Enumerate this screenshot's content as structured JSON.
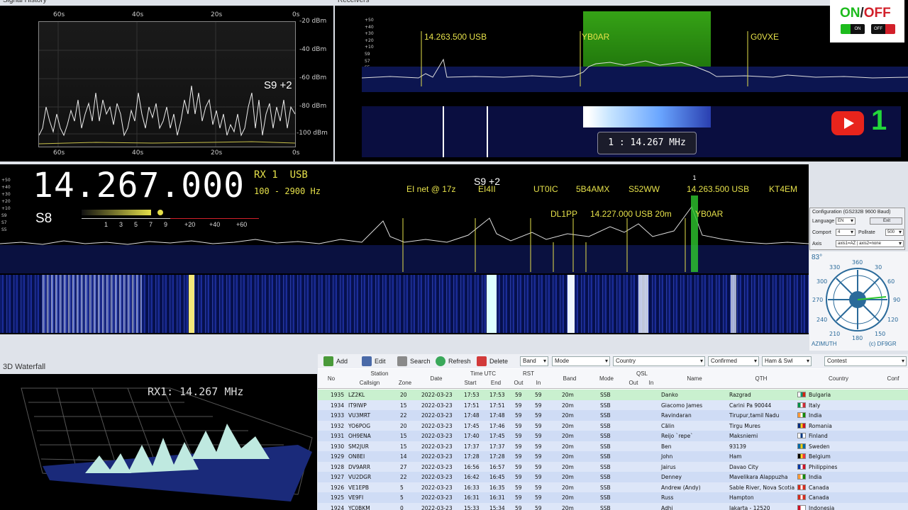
{
  "signal_history": {
    "title": "Signal History",
    "time_ticks": [
      "60s",
      "40s",
      "20s",
      "0s"
    ],
    "dbm_ticks": [
      "-20 dBm",
      "-40 dBm",
      "-60 dBm",
      "-80 dBm",
      "-100 dBm"
    ],
    "s_reading": "S9 +2"
  },
  "receivers": {
    "title": "Receivers",
    "db_ticks": [
      "+50",
      "+40",
      "+30",
      "+20",
      "+10",
      "S9",
      "S7",
      "S5",
      "S3"
    ],
    "markers": [
      "14.263.500 USB",
      "YB0AR",
      "G0VXE"
    ],
    "tuner_readout": "1 : 14.267 MHz",
    "channel_number": "1"
  },
  "onoff": {
    "on_label": "ON",
    "sep": "/",
    "off_label": "OFF",
    "on_sw": "ON",
    "off_sw": "OFF"
  },
  "main": {
    "frequency": "14.267.000",
    "rx_label": "RX 1",
    "mode": "USB",
    "bandwidth": "100 - 2900 Hz",
    "s_meter": "S8",
    "s_scale": [
      "1",
      "3",
      "5",
      "7",
      "9",
      "+20",
      "+40",
      "+60"
    ],
    "peak_label": "S9 +2",
    "db_ticks": [
      "+50",
      "+40",
      "+30",
      "+20",
      "+10",
      "S9",
      "S7",
      "S5"
    ],
    "spots": [
      "EI net @ 17z",
      "EI4II",
      "UT0IC",
      "5B4AMX",
      "S52WW",
      "14.263.500 USB",
      "KT4EM",
      "DL1PP",
      "14.227.000 USB 20m",
      "YB0AR"
    ],
    "spot_tag": "1"
  },
  "config": {
    "title": "Configuration (GS232B 9600 Baud)",
    "language_label": "Language",
    "language": "EN",
    "exit": "Exit",
    "comport_label": "Comport",
    "comport": "4",
    "pollrate_label": "Pollrate",
    "pollrate": "500",
    "axis_label": "Axis",
    "axis": "axis1=AZ | axis2=none"
  },
  "compass": {
    "reading": "83°",
    "degrees": [
      "360",
      "30",
      "60",
      "90",
      "120",
      "150",
      "180",
      "210",
      "240",
      "270",
      "300",
      "330"
    ],
    "label": "AZIMUTH",
    "credit": "(c) DF9GR"
  },
  "waterfall3d": {
    "title": "3D Waterfall",
    "label": "RX1: 14.267 MHz"
  },
  "log": {
    "toolbar": {
      "add": "Add",
      "edit": "Edit",
      "search": "Search",
      "refresh": "Refresh",
      "delete": "Delete"
    },
    "filters": [
      "Band",
      "Mode",
      "Country",
      "Confirmed",
      "Ham & Swl",
      "Contest"
    ],
    "headers": {
      "no": "No",
      "station": "Station",
      "callsign": "Callsign",
      "zone": "Zone",
      "date": "Date",
      "time_utc": "Time UTC",
      "start": "Start",
      "end": "End",
      "rst": "RST",
      "out": "Out",
      "in": "In",
      "band": "Band",
      "mode": "Mode",
      "qsl": "QSL",
      "qsl_out": "Out",
      "qsl_in": "In",
      "name": "Name",
      "qth": "QTH",
      "country": "Country",
      "conf": "Conf"
    },
    "rows": [
      {
        "no": "1935",
        "call": "LZ2KL",
        "zone": "20",
        "date": "2022-03-23",
        "start": "17:53",
        "end": "17:53",
        "out": "59",
        "in": "59",
        "band": "20m",
        "mode": "SSB",
        "name": "Danko",
        "qth": "Razgrad",
        "country": "Bulgaria",
        "flag": [
          "#ffffff",
          "#00966e",
          "#d62612"
        ]
      },
      {
        "no": "1934",
        "call": "IT9IWP",
        "zone": "15",
        "date": "2022-03-23",
        "start": "17:51",
        "end": "17:51",
        "out": "59",
        "in": "59",
        "band": "20m",
        "mode": "SSB",
        "name": "Giacomo James",
        "qth": "Carini Pa 90044",
        "country": "Italy",
        "flag": [
          "#009246",
          "#ffffff",
          "#ce2b37"
        ]
      },
      {
        "no": "1933",
        "call": "VU3MRT",
        "zone": "22",
        "date": "2022-03-23",
        "start": "17:48",
        "end": "17:48",
        "out": "59",
        "in": "59",
        "band": "20m",
        "mode": "SSB",
        "name": "Ravindaran",
        "qth": "Tirupur,tamil Nadu",
        "country": "India",
        "flag": [
          "#ff9933",
          "#ffffff",
          "#138808"
        ]
      },
      {
        "no": "1932",
        "call": "YO6POG",
        "zone": "20",
        "date": "2022-03-23",
        "start": "17:45",
        "end": "17:46",
        "out": "59",
        "in": "59",
        "band": "20m",
        "mode": "SSB",
        "name": "Călin",
        "qth": "Tirgu Mures",
        "country": "Romania",
        "flag": [
          "#002b7f",
          "#fcd116",
          "#ce1126"
        ]
      },
      {
        "no": "1931",
        "call": "OH9ENA",
        "zone": "15",
        "date": "2022-03-23",
        "start": "17:40",
        "end": "17:45",
        "out": "59",
        "in": "59",
        "band": "20m",
        "mode": "SSB",
        "name": "Reijo `repe`",
        "qth": "Maksniemi",
        "country": "Finland",
        "flag": [
          "#ffffff",
          "#003580",
          "#ffffff"
        ]
      },
      {
        "no": "1930",
        "call": "SM2JUR",
        "zone": "15",
        "date": "2022-03-23",
        "start": "17:37",
        "end": "17:37",
        "out": "59",
        "in": "59",
        "band": "20m",
        "mode": "SSB",
        "name": "Ben",
        "qth": "93139",
        "country": "Sweden",
        "flag": [
          "#006aa7",
          "#fecc00",
          "#006aa7"
        ]
      },
      {
        "no": "1929",
        "call": "ON8EI",
        "zone": "14",
        "date": "2022-03-23",
        "start": "17:28",
        "end": "17:28",
        "out": "59",
        "in": "59",
        "band": "20m",
        "mode": "SSB",
        "name": "John",
        "qth": "Ham",
        "country": "Belgium",
        "flag": [
          "#000000",
          "#fdda24",
          "#ef3340"
        ]
      },
      {
        "no": "1928",
        "call": "DV9ARR",
        "zone": "27",
        "date": "2022-03-23",
        "start": "16:56",
        "end": "16:57",
        "out": "59",
        "in": "59",
        "band": "20m",
        "mode": "SSB",
        "name": "Jairus",
        "qth": "Davao City",
        "country": "Philippines",
        "flag": [
          "#0038a8",
          "#ffffff",
          "#ce1126"
        ]
      },
      {
        "no": "1927",
        "call": "VU2DGR",
        "zone": "22",
        "date": "2022-03-23",
        "start": "16:42",
        "end": "16:45",
        "out": "59",
        "in": "59",
        "band": "20m",
        "mode": "SSB",
        "name": "Denney",
        "qth": "Mavelikara Alappuzha",
        "country": "India",
        "flag": [
          "#ff9933",
          "#ffffff",
          "#138808"
        ]
      },
      {
        "no": "1926",
        "call": "VE1EPB",
        "zone": "5",
        "date": "2022-03-23",
        "start": "16:33",
        "end": "16:35",
        "out": "59",
        "in": "59",
        "band": "20m",
        "mode": "SSB",
        "name": "Andrew (Andy)",
        "qth": "Sable River, Nova Scotia",
        "country": "Canada",
        "flag": [
          "#d52b1e",
          "#ffffff",
          "#d52b1e"
        ]
      },
      {
        "no": "1925",
        "call": "VE9FI",
        "zone": "5",
        "date": "2022-03-23",
        "start": "16:31",
        "end": "16:31",
        "out": "59",
        "in": "59",
        "band": "20m",
        "mode": "SSB",
        "name": "Russ",
        "qth": "Hampton",
        "country": "Canada",
        "flag": [
          "#d52b1e",
          "#ffffff",
          "#d52b1e"
        ]
      },
      {
        "no": "1924",
        "call": "YC0BKM",
        "zone": "0",
        "date": "2022-03-23",
        "start": "15:33",
        "end": "15:34",
        "out": "59",
        "in": "59",
        "band": "20m",
        "mode": "SSB",
        "name": "Adhi",
        "qth": "Jakarta - 12520",
        "country": "Indonesia",
        "flag": [
          "#ce1126",
          "#ffffff",
          "#ffffff"
        ]
      }
    ]
  }
}
